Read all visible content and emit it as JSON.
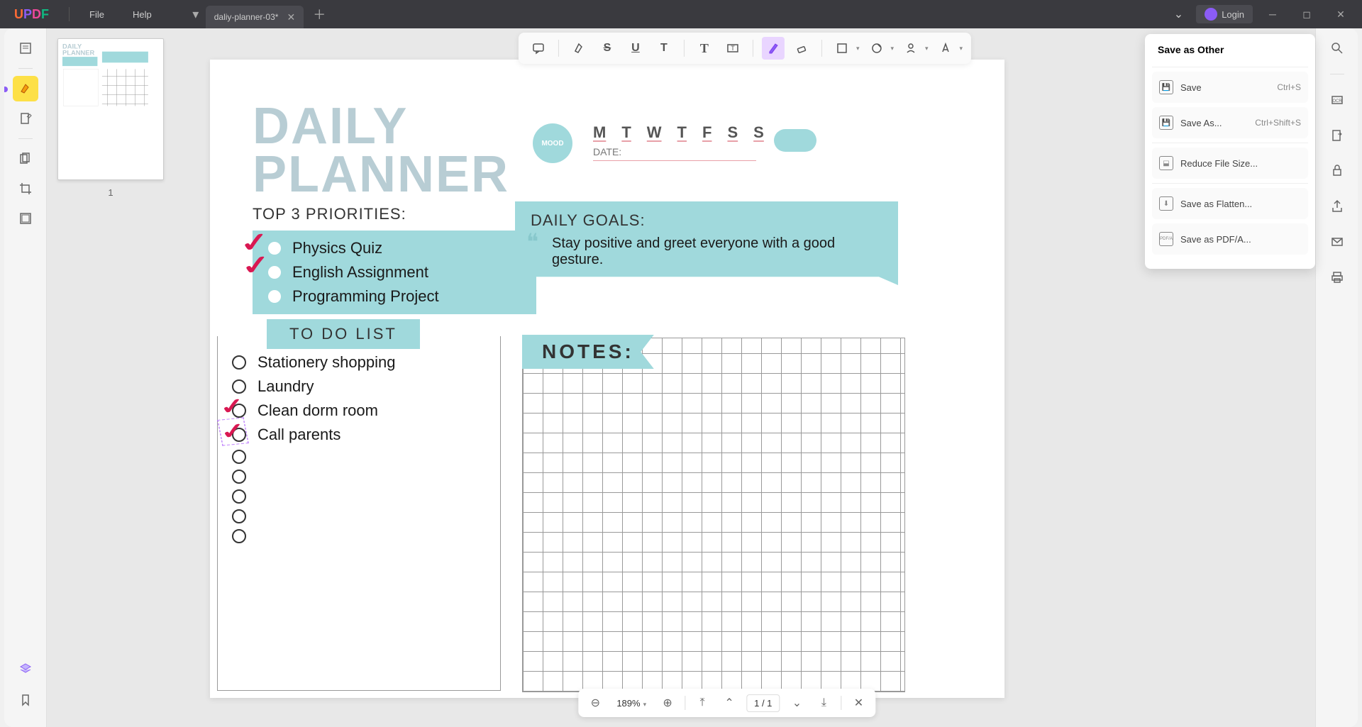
{
  "titlebar": {
    "file": "File",
    "help": "Help",
    "tab_name": "daliy-planner-03*",
    "login": "Login"
  },
  "thumbnail": {
    "page_num": "1"
  },
  "doc": {
    "title_l1": "DAILY",
    "title_l2": "PLANNER",
    "priorities_label": "TOP 3 PRIORITIES:",
    "mood": "MOOD",
    "days": [
      "M",
      "T",
      "W",
      "T",
      "F",
      "S",
      "S"
    ],
    "date_label": "DATE:",
    "priorities": [
      "Physics Quiz",
      "English Assignment",
      "Programming Project"
    ],
    "goals_label": "DAILY GOALS:",
    "goals_text": "Stay positive and greet everyone with a good gesture.",
    "todo_label": "TO DO LIST",
    "todo_items": [
      "Stationery shopping",
      "Laundry",
      "Clean dorm room",
      "Call parents"
    ],
    "notes_label": "NOTES:"
  },
  "save_menu": {
    "title": "Save as Other",
    "save": "Save",
    "save_sc": "Ctrl+S",
    "saveas": "Save As...",
    "saveas_sc": "Ctrl+Shift+S",
    "reduce": "Reduce File Size...",
    "flatten": "Save as Flatten...",
    "pdfa": "Save as PDF/A..."
  },
  "page_nav": {
    "zoom": "189%",
    "page": "1 / 1"
  }
}
